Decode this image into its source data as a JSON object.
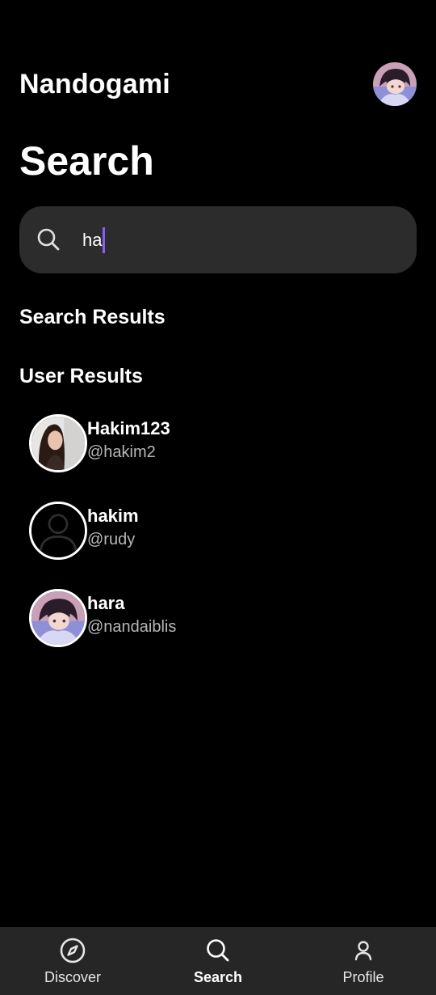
{
  "header": {
    "app_title": "Nandogami"
  },
  "page": {
    "title": "Search"
  },
  "search": {
    "value": "ha"
  },
  "sections": {
    "search_results": "Search Results",
    "user_results": "User Results"
  },
  "users": [
    {
      "name": "Hakim123",
      "handle": "@hakim2",
      "avatar": "photo-girl"
    },
    {
      "name": "hakim",
      "handle": "@rudy",
      "avatar": "default-person"
    },
    {
      "name": "hara",
      "handle": "@nandaiblis",
      "avatar": "anime-character"
    }
  ],
  "nav": {
    "items": [
      {
        "label": "Discover",
        "icon": "compass-icon"
      },
      {
        "label": "Search",
        "icon": "search-icon"
      },
      {
        "label": "Profile",
        "icon": "person-icon"
      }
    ],
    "active": "Search"
  },
  "colors": {
    "background": "#000000",
    "search_bg": "#2c2c2c",
    "caret": "#8b5cf6",
    "nav_bg": "#262626"
  }
}
